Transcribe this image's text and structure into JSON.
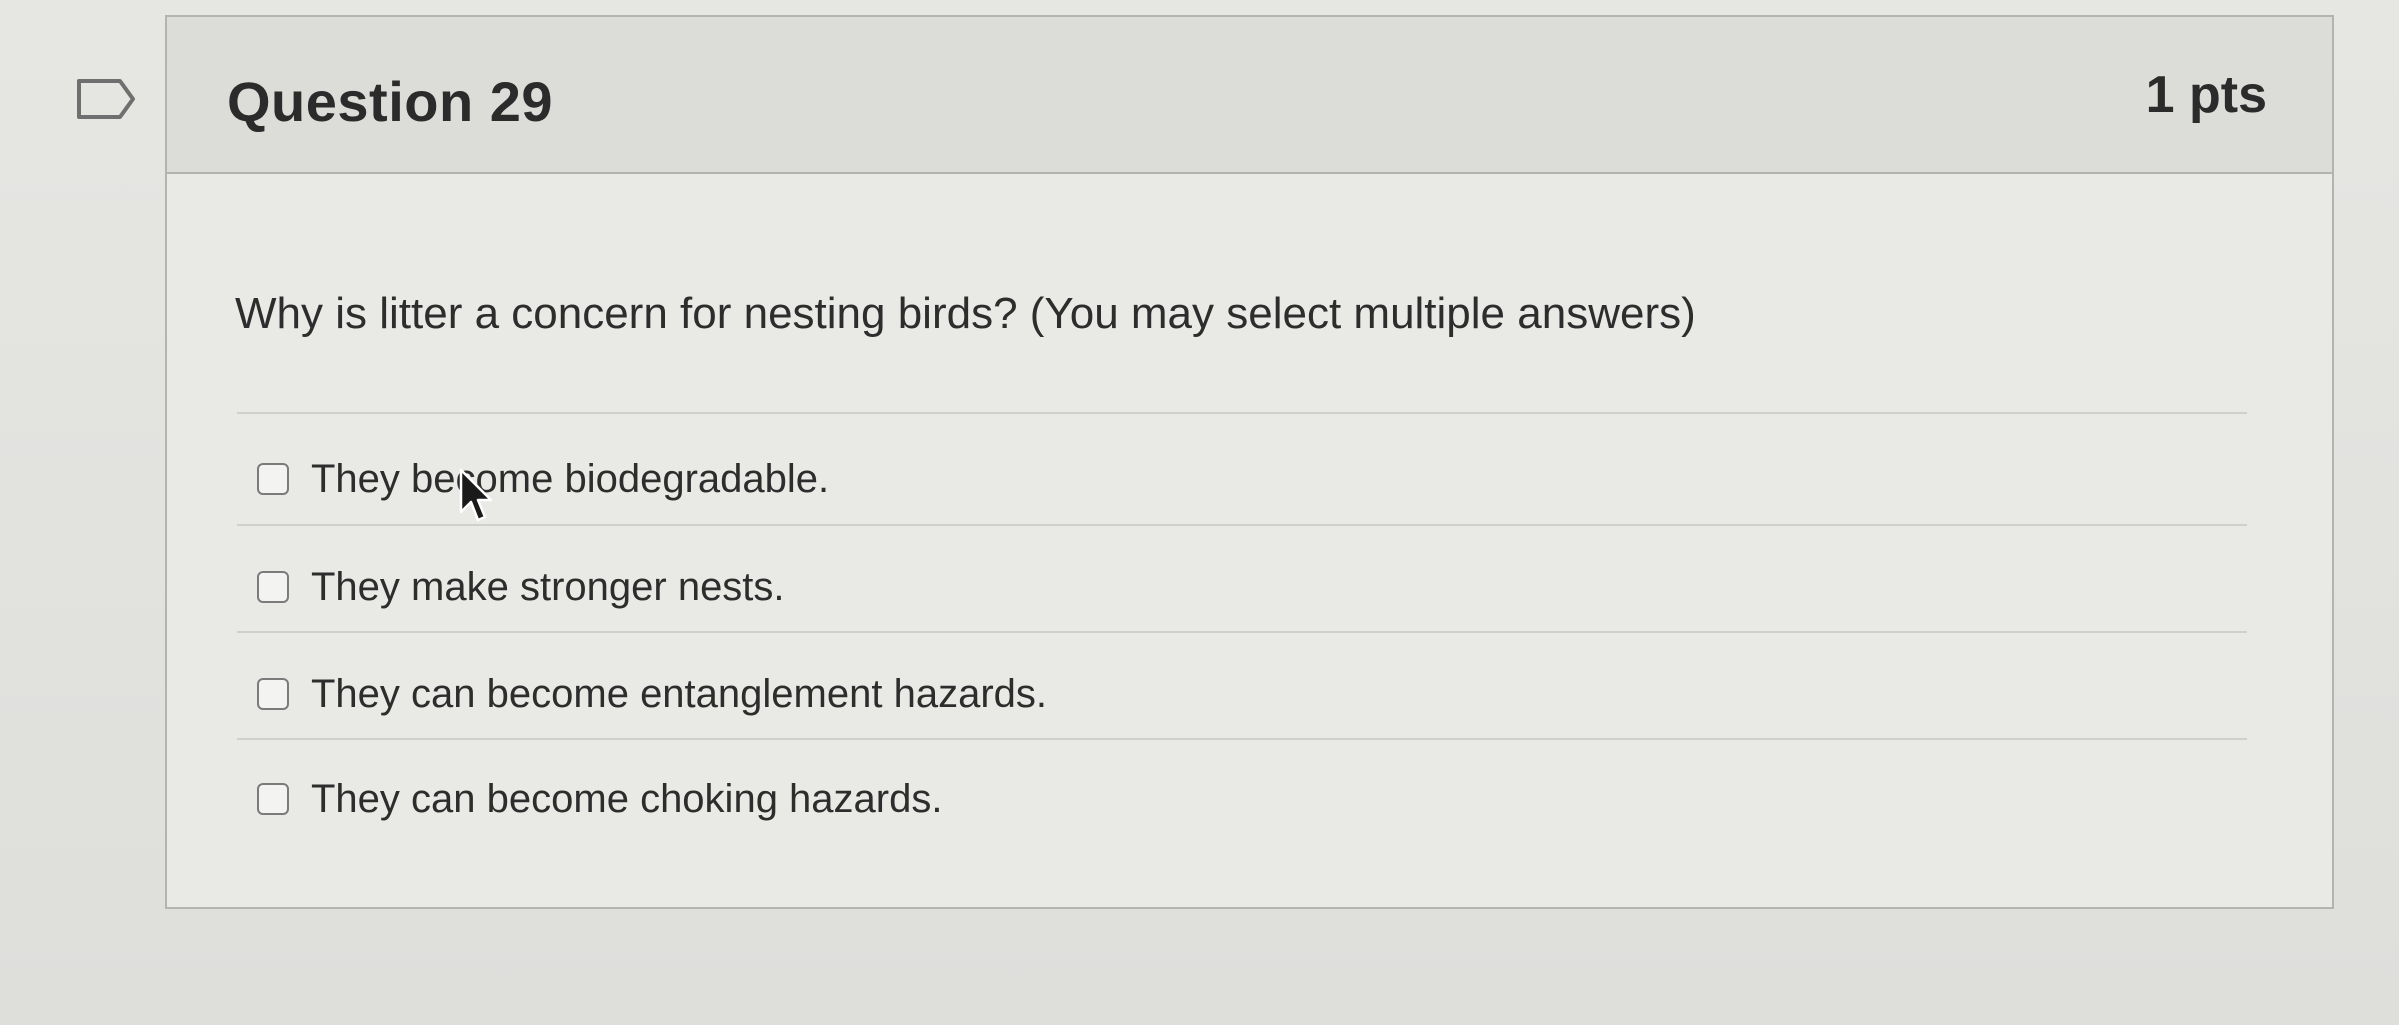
{
  "question": {
    "title": "Question 29",
    "points": "1 pts",
    "text": "Why is litter  a concern for nesting birds? (You may select multiple answers)"
  },
  "answers": [
    {
      "label": "They become biodegradable.",
      "checked": false
    },
    {
      "label": "They make stronger nests.",
      "checked": false
    },
    {
      "label": "They can become entanglement hazards.",
      "checked": false
    },
    {
      "label": "They can become choking hazards.",
      "checked": false
    }
  ],
  "icons": {
    "flag": "flag-question-icon",
    "cursor": "mouse-pointer-icon"
  },
  "colors": {
    "text": "#2d2d2d",
    "border": "#b3b3b0",
    "header_bg": "#dcdcd9"
  }
}
